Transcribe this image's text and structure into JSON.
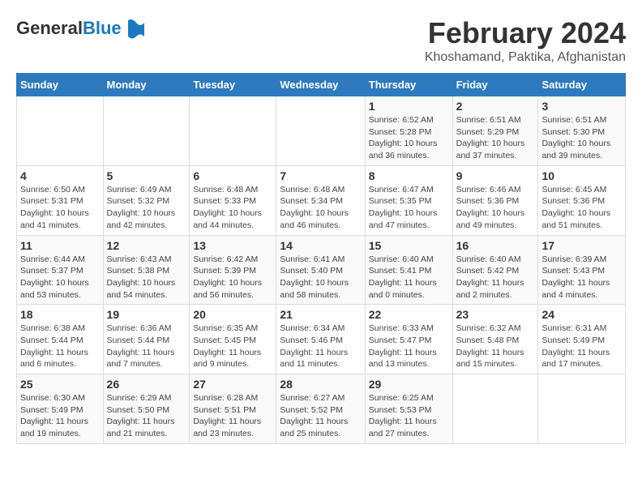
{
  "logo": {
    "general": "General",
    "blue": "Blue"
  },
  "header": {
    "month": "February 2024",
    "location": "Khoshamand, Paktika, Afghanistan"
  },
  "weekdays": [
    "Sunday",
    "Monday",
    "Tuesday",
    "Wednesday",
    "Thursday",
    "Friday",
    "Saturday"
  ],
  "weeks": [
    [
      {
        "day": "",
        "info": ""
      },
      {
        "day": "",
        "info": ""
      },
      {
        "day": "",
        "info": ""
      },
      {
        "day": "",
        "info": ""
      },
      {
        "day": "1",
        "info": "Sunrise: 6:52 AM\nSunset: 5:28 PM\nDaylight: 10 hours and 36 minutes."
      },
      {
        "day": "2",
        "info": "Sunrise: 6:51 AM\nSunset: 5:29 PM\nDaylight: 10 hours and 37 minutes."
      },
      {
        "day": "3",
        "info": "Sunrise: 6:51 AM\nSunset: 5:30 PM\nDaylight: 10 hours and 39 minutes."
      }
    ],
    [
      {
        "day": "4",
        "info": "Sunrise: 6:50 AM\nSunset: 5:31 PM\nDaylight: 10 hours and 41 minutes."
      },
      {
        "day": "5",
        "info": "Sunrise: 6:49 AM\nSunset: 5:32 PM\nDaylight: 10 hours and 42 minutes."
      },
      {
        "day": "6",
        "info": "Sunrise: 6:48 AM\nSunset: 5:33 PM\nDaylight: 10 hours and 44 minutes."
      },
      {
        "day": "7",
        "info": "Sunrise: 6:48 AM\nSunset: 5:34 PM\nDaylight: 10 hours and 46 minutes."
      },
      {
        "day": "8",
        "info": "Sunrise: 6:47 AM\nSunset: 5:35 PM\nDaylight: 10 hours and 47 minutes."
      },
      {
        "day": "9",
        "info": "Sunrise: 6:46 AM\nSunset: 5:36 PM\nDaylight: 10 hours and 49 minutes."
      },
      {
        "day": "10",
        "info": "Sunrise: 6:45 AM\nSunset: 5:36 PM\nDaylight: 10 hours and 51 minutes."
      }
    ],
    [
      {
        "day": "11",
        "info": "Sunrise: 6:44 AM\nSunset: 5:37 PM\nDaylight: 10 hours and 53 minutes."
      },
      {
        "day": "12",
        "info": "Sunrise: 6:43 AM\nSunset: 5:38 PM\nDaylight: 10 hours and 54 minutes."
      },
      {
        "day": "13",
        "info": "Sunrise: 6:42 AM\nSunset: 5:39 PM\nDaylight: 10 hours and 56 minutes."
      },
      {
        "day": "14",
        "info": "Sunrise: 6:41 AM\nSunset: 5:40 PM\nDaylight: 10 hours and 58 minutes."
      },
      {
        "day": "15",
        "info": "Sunrise: 6:40 AM\nSunset: 5:41 PM\nDaylight: 11 hours and 0 minutes."
      },
      {
        "day": "16",
        "info": "Sunrise: 6:40 AM\nSunset: 5:42 PM\nDaylight: 11 hours and 2 minutes."
      },
      {
        "day": "17",
        "info": "Sunrise: 6:39 AM\nSunset: 5:43 PM\nDaylight: 11 hours and 4 minutes."
      }
    ],
    [
      {
        "day": "18",
        "info": "Sunrise: 6:38 AM\nSunset: 5:44 PM\nDaylight: 11 hours and 6 minutes."
      },
      {
        "day": "19",
        "info": "Sunrise: 6:36 AM\nSunset: 5:44 PM\nDaylight: 11 hours and 7 minutes."
      },
      {
        "day": "20",
        "info": "Sunrise: 6:35 AM\nSunset: 5:45 PM\nDaylight: 11 hours and 9 minutes."
      },
      {
        "day": "21",
        "info": "Sunrise: 6:34 AM\nSunset: 5:46 PM\nDaylight: 11 hours and 11 minutes."
      },
      {
        "day": "22",
        "info": "Sunrise: 6:33 AM\nSunset: 5:47 PM\nDaylight: 11 hours and 13 minutes."
      },
      {
        "day": "23",
        "info": "Sunrise: 6:32 AM\nSunset: 5:48 PM\nDaylight: 11 hours and 15 minutes."
      },
      {
        "day": "24",
        "info": "Sunrise: 6:31 AM\nSunset: 5:49 PM\nDaylight: 11 hours and 17 minutes."
      }
    ],
    [
      {
        "day": "25",
        "info": "Sunrise: 6:30 AM\nSunset: 5:49 PM\nDaylight: 11 hours and 19 minutes."
      },
      {
        "day": "26",
        "info": "Sunrise: 6:29 AM\nSunset: 5:50 PM\nDaylight: 11 hours and 21 minutes."
      },
      {
        "day": "27",
        "info": "Sunrise: 6:28 AM\nSunset: 5:51 PM\nDaylight: 11 hours and 23 minutes."
      },
      {
        "day": "28",
        "info": "Sunrise: 6:27 AM\nSunset: 5:52 PM\nDaylight: 11 hours and 25 minutes."
      },
      {
        "day": "29",
        "info": "Sunrise: 6:25 AM\nSunset: 5:53 PM\nDaylight: 11 hours and 27 minutes."
      },
      {
        "day": "",
        "info": ""
      },
      {
        "day": "",
        "info": ""
      }
    ]
  ]
}
